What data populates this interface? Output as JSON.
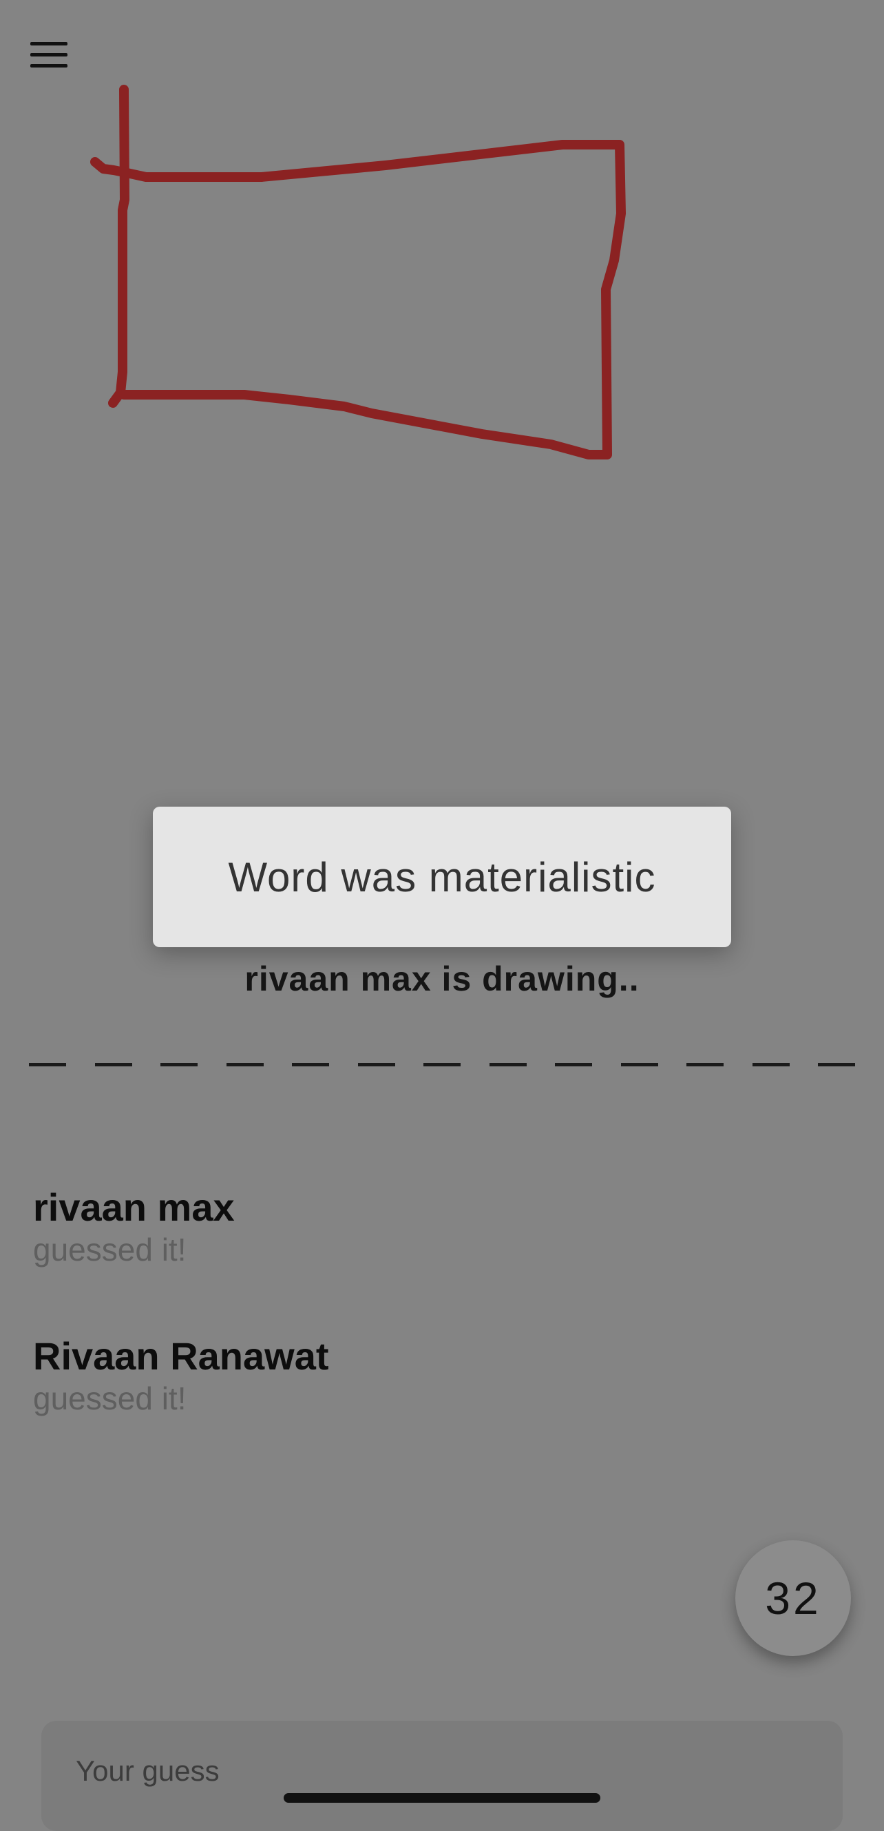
{
  "colors": {
    "background": "#848484",
    "stroke": "#8b2222",
    "dialog_bg": "#e5e5e5",
    "timer_bg": "#8c8c8c"
  },
  "toolbar": {
    "menu_icon": "hamburger-menu-icon"
  },
  "dialog": {
    "text": "Word was materialistic"
  },
  "status": {
    "drawer_text": "rivaan max is drawing.."
  },
  "word": {
    "blank_count": 13
  },
  "guesses": [
    {
      "name": "rivaan max",
      "status": "guessed it!"
    },
    {
      "name": "Rivaan Ranawat",
      "status": "guessed it!"
    }
  ],
  "timer": {
    "value": "32"
  },
  "guess_input": {
    "placeholder": "Your guess",
    "value": ""
  }
}
